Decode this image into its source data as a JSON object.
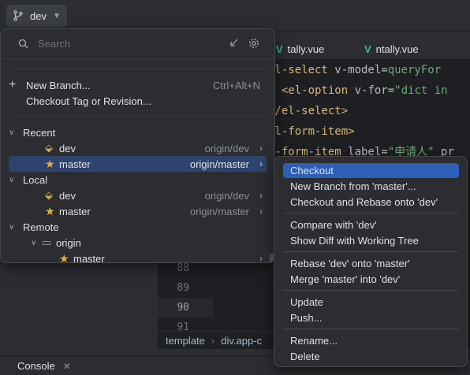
{
  "toolbar": {
    "branch": "dev"
  },
  "editor": {
    "tabs": [
      "tally.vue",
      "ntally.vue"
    ],
    "code_lines": [
      {
        "parts": [
          {
            "c": "tag",
            "t": "el-select"
          },
          {
            "c": "attr",
            "t": " v-model="
          },
          {
            "c": "str",
            "t": "queryFor"
          }
        ]
      },
      {
        "parts": [
          {
            "c": "attr",
            "t": "  "
          },
          {
            "c": "tag",
            "t": "<el-option"
          },
          {
            "c": "attr",
            "t": " v-for="
          },
          {
            "c": "str",
            "t": "\"dict in"
          }
        ]
      },
      {
        "parts": [
          {
            "c": "tag",
            "t": "</el-select>"
          }
        ]
      },
      {
        "parts": [
          {
            "c": "tag",
            "t": "el-form-item>"
          }
        ]
      },
      {
        "parts": [
          {
            "c": "tag",
            "t": "l-form-item"
          },
          {
            "c": "attr",
            "t": " label="
          },
          {
            "c": "str",
            "t": "\"申请人\""
          },
          {
            "c": "attr",
            "t": " pr"
          }
        ]
      }
    ],
    "line_numbers": [
      "88",
      "89",
      "90",
      "91"
    ],
    "breadcrumbs": [
      "template",
      "div.app-c"
    ]
  },
  "bottom": {
    "console_label": "Console"
  },
  "popup": {
    "search_placeholder": "Search",
    "new_branch": "New Branch...",
    "new_branch_shortcut": "Ctrl+Alt+N",
    "checkout_tag": "Checkout Tag or Revision...",
    "recent_label": "Recent",
    "recent": [
      {
        "name": "dev",
        "tracking": "origin/dev"
      },
      {
        "name": "master",
        "tracking": "origin/master"
      }
    ],
    "local_label": "Local",
    "local": [
      {
        "name": "dev",
        "tracking": "origin/dev"
      },
      {
        "name": "master",
        "tracking": "origin/master"
      }
    ],
    "remote_label": "Remote",
    "remote_folder": "origin",
    "remote_branch": "master"
  },
  "submenu": {
    "items": [
      "Checkout",
      "New Branch from 'master'...",
      "Checkout and Rebase onto 'dev'",
      "Compare with 'dev'",
      "Show Diff with Working Tree",
      "Rebase 'dev' onto 'master'",
      "Merge 'master' into 'dev'",
      "Update",
      "Push...",
      "Rename...",
      "Delete"
    ]
  },
  "colors": {
    "selection": "#2e436e",
    "menu_selection": "#2e5fb6",
    "star": "#e8b13a"
  },
  "icons": [
    "branch-icon",
    "search-icon",
    "arrow-icon",
    "settings-icon",
    "plus-icon",
    "tag-icon",
    "star-icon",
    "folder-icon",
    "vue-icon",
    "chevron-right-icon"
  ]
}
